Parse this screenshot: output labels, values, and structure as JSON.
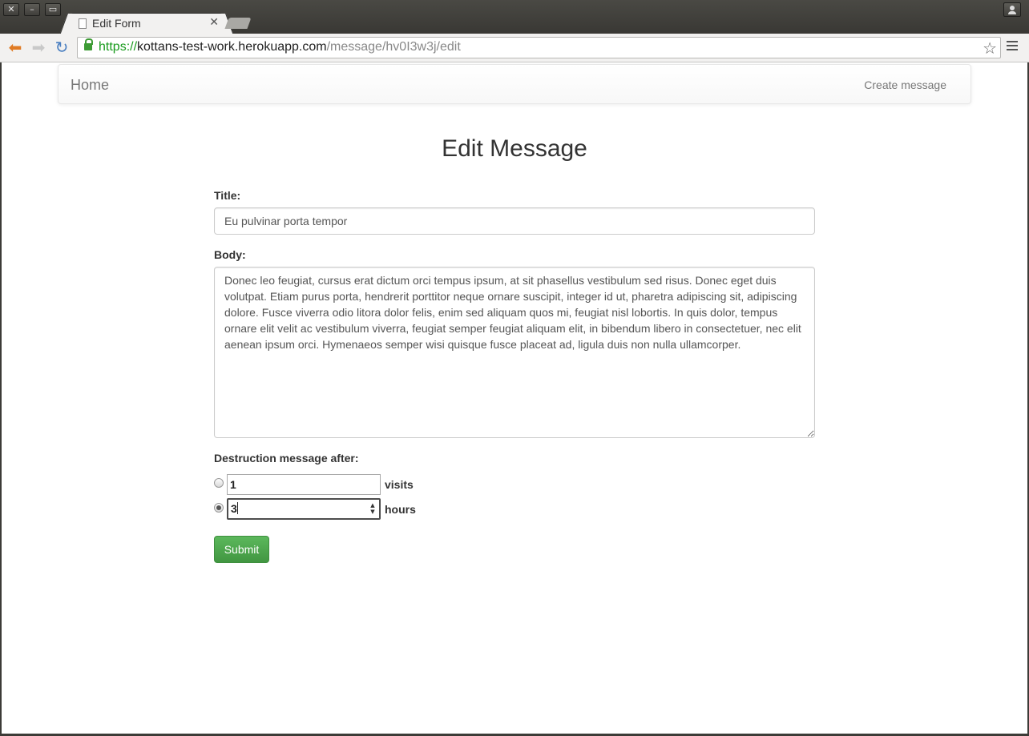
{
  "browser": {
    "tab_title": "Edit Form",
    "url_scheme": "https://",
    "url_host": "kottans-test-work.herokuapp.com",
    "url_path": "/message/hv0I3w3j/edit",
    "icons": [
      "back-icon",
      "forward-icon",
      "reload-icon",
      "lock-icon",
      "star-icon",
      "menu-icon"
    ]
  },
  "navbar": {
    "brand": "Home",
    "create_link": "Create message"
  },
  "page": {
    "heading": "Edit Message"
  },
  "form": {
    "title_label": "Title:",
    "title_value": "Eu pulvinar porta tempor",
    "body_label": "Body:",
    "body_value": "Donec leo feugiat, cursus erat dictum orci tempus ipsum, at sit phasellus vestibulum sed risus. Donec eget duis volutpat. Etiam purus porta, hendrerit porttitor neque ornare suscipit, integer id ut, pharetra adipiscing sit, adipiscing dolore. Fusce viverra odio litora dolor felis, enim sed aliquam quos mi, feugiat nisl lobortis. In quis dolor, tempus ornare elit velit ac vestibulum viverra, feugiat semper feugiat aliquam elit, in bibendum libero in consectetuer, nec elit aenean ipsum orci. Hymenaeos semper wisi quisque fusce placeat ad, ligula duis non nulla ullamcorper.",
    "destruction_label": "Destruction message after:",
    "visits_value": "1",
    "visits_unit": "visits",
    "visits_selected": false,
    "hours_value": "3",
    "hours_unit": "hours",
    "hours_selected": true,
    "submit_label": "Submit"
  },
  "colors": {
    "submit_green": "#5cb85c",
    "url_green": "#179a1b",
    "back_orange": "#e07b24"
  }
}
